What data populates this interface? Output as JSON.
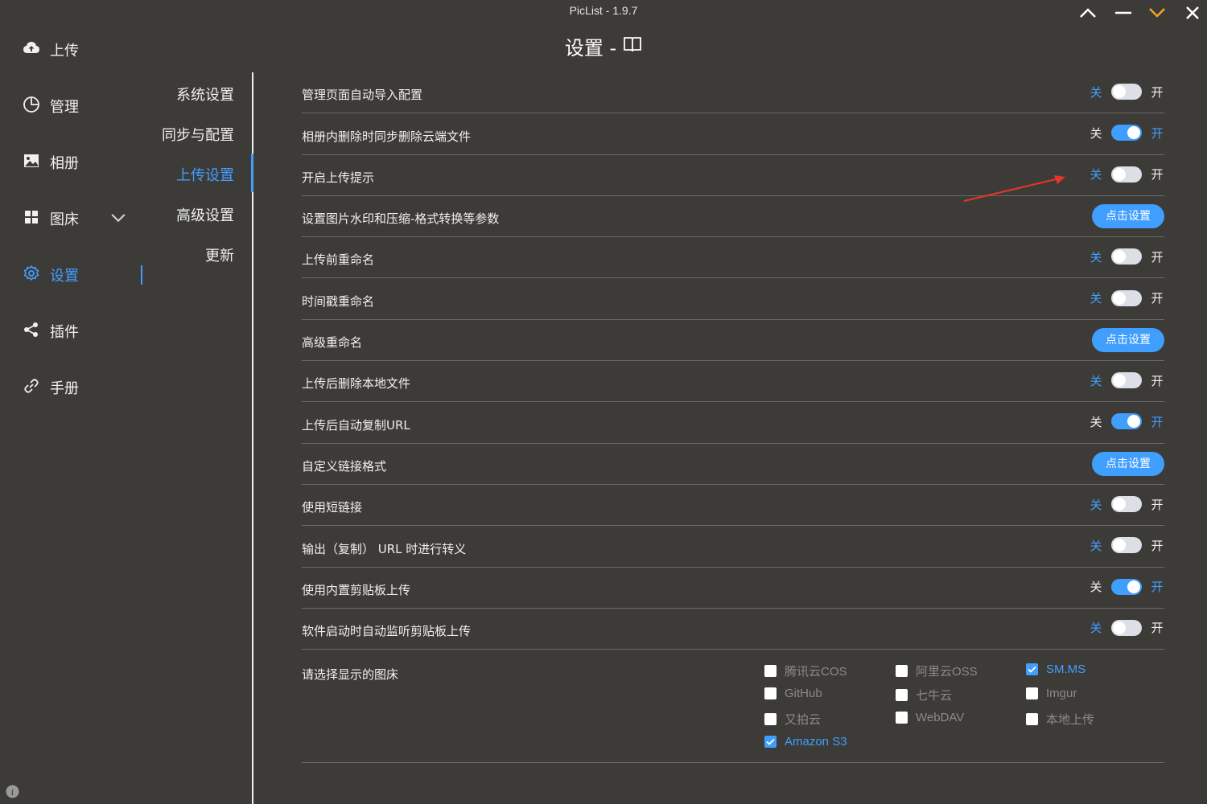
{
  "window": {
    "title": "PicList - 1.9.7",
    "controls": [
      "chevron-up-icon",
      "minimize-icon",
      "chevron-down-icon",
      "close-icon"
    ],
    "accent_color": "#409eff",
    "min_chevron_color": "#f5a623"
  },
  "page": {
    "heading": "设置 -",
    "heading_icon": "book-icon"
  },
  "sidebar": {
    "items": [
      {
        "label": "上传",
        "icon": "upload-cloud-icon"
      },
      {
        "label": "管理",
        "icon": "pie-chart-icon"
      },
      {
        "label": "相册",
        "icon": "image-icon"
      },
      {
        "label": "图床",
        "icon": "grid-icon"
      },
      {
        "label": "设置",
        "icon": "gear-icon"
      },
      {
        "label": "插件",
        "icon": "share-icon"
      },
      {
        "label": "手册",
        "icon": "link-icon"
      }
    ],
    "active": "设置"
  },
  "submenu": {
    "items": [
      "系统设置",
      "同步与配置",
      "上传设置",
      "高级设置",
      "更新"
    ],
    "active": "上传设置"
  },
  "toggle_labels": {
    "off": "关",
    "on": "开"
  },
  "settings": [
    {
      "label": "管理页面自动导入配置",
      "type": "toggle",
      "value": false
    },
    {
      "label": "相册内删除时同步删除云端文件",
      "type": "toggle",
      "value": true
    },
    {
      "label": "开启上传提示",
      "type": "toggle",
      "value": false
    },
    {
      "label": "设置图片水印和压缩-格式转换等参数",
      "type": "button",
      "button_label": "点击设置"
    },
    {
      "label": "上传前重命名",
      "type": "toggle",
      "value": false
    },
    {
      "label": "时间戳重命名",
      "type": "toggle",
      "value": false
    },
    {
      "label": "高级重命名",
      "type": "button",
      "button_label": "点击设置"
    },
    {
      "label": "上传后删除本地文件",
      "type": "toggle",
      "value": false
    },
    {
      "label": "上传后自动复制URL",
      "type": "toggle",
      "value": true
    },
    {
      "label": "自定义链接格式",
      "type": "button",
      "button_label": "点击设置"
    },
    {
      "label": "使用短链接",
      "type": "toggle",
      "value": false
    },
    {
      "label": "输出（复制） URL 时进行转义",
      "type": "toggle",
      "value": false
    },
    {
      "label": "使用内置剪贴板上传",
      "type": "toggle",
      "value": true
    },
    {
      "label": "软件启动时自动监听剪贴板上传",
      "type": "toggle",
      "value": false
    }
  ],
  "picbeds": {
    "label": "请选择显示的图床",
    "options": [
      {
        "name": "腾讯云COS",
        "checked": false
      },
      {
        "name": "阿里云OSS",
        "checked": false
      },
      {
        "name": "SM.MS",
        "checked": true
      },
      {
        "name": "GitHub",
        "checked": false
      },
      {
        "name": "七牛云",
        "checked": false
      },
      {
        "name": "Imgur",
        "checked": false
      },
      {
        "name": "又拍云",
        "checked": false
      },
      {
        "name": "WebDAV",
        "checked": false
      },
      {
        "name": "本地上传",
        "checked": false
      },
      {
        "name": "Amazon S3",
        "checked": true
      }
    ]
  },
  "annotation": {
    "color": "#e8342b",
    "points_to": "开启上传提示 toggle"
  }
}
